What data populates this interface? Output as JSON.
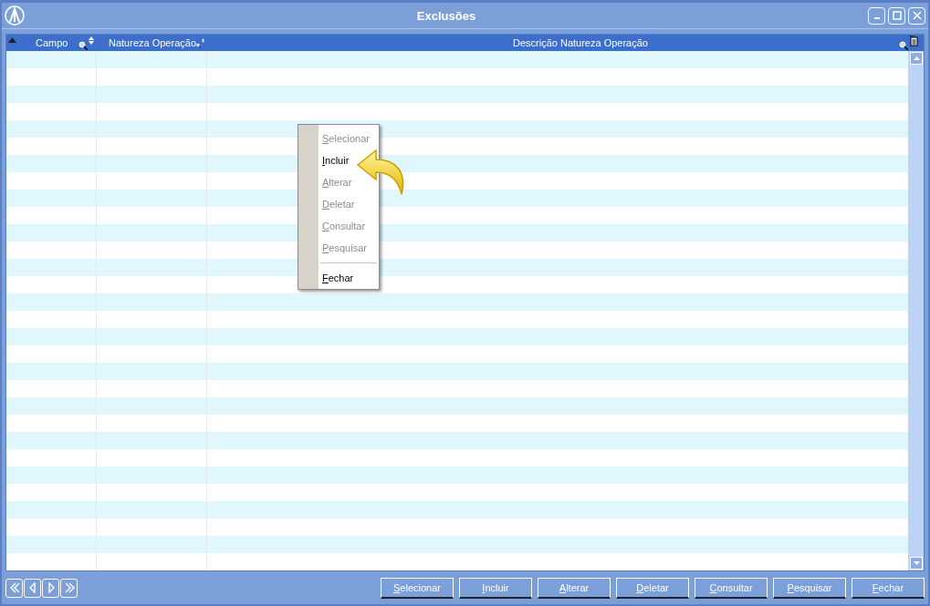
{
  "window": {
    "title": "Exclusões"
  },
  "table": {
    "columns": [
      {
        "label": "Campo",
        "kind": "sortable"
      },
      {
        "label": "Natureza Operação",
        "kind": "sortable"
      },
      {
        "label": "Descrição Natureza Operação",
        "kind": "chooser"
      }
    ]
  },
  "context_menu": {
    "items": [
      {
        "label": "Selecionar",
        "disabled": true,
        "kind": "item"
      },
      {
        "label": "Incluir",
        "disabled": false,
        "kind": "item"
      },
      {
        "label": "Alterar",
        "disabled": true,
        "kind": "item"
      },
      {
        "label": "Deletar",
        "disabled": true,
        "kind": "item"
      },
      {
        "label": "Consultar",
        "disabled": true,
        "kind": "item"
      },
      {
        "label": "Pesquisar",
        "disabled": true,
        "kind": "item"
      },
      {
        "kind": "separator"
      },
      {
        "label": "Fechar",
        "disabled": false,
        "kind": "item"
      }
    ]
  },
  "buttons": [
    "Selecionar",
    "Incluir",
    "Alterar",
    "Deletar",
    "Consultar",
    "Pesquisar",
    "Fechar"
  ]
}
